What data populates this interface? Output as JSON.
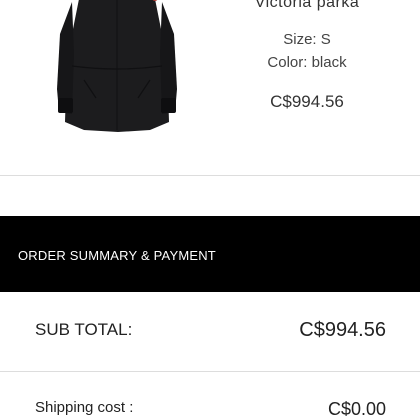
{
  "product": {
    "name": "Victoria parka",
    "size": "Size: S",
    "color": "Color: black",
    "price": "C$994.56",
    "image_icon": "parka-image"
  },
  "summary": {
    "header": "ORDER SUMMARY & PAYMENT",
    "subtotal_label": "SUB TOTAL:",
    "subtotal_value": "C$994.56",
    "shipping_label": "Shipping cost :",
    "shipping_value": "C$0.00"
  },
  "colors": {
    "header_bg": "#000000",
    "header_text": "#ffffff",
    "divider": "#dddddd"
  }
}
